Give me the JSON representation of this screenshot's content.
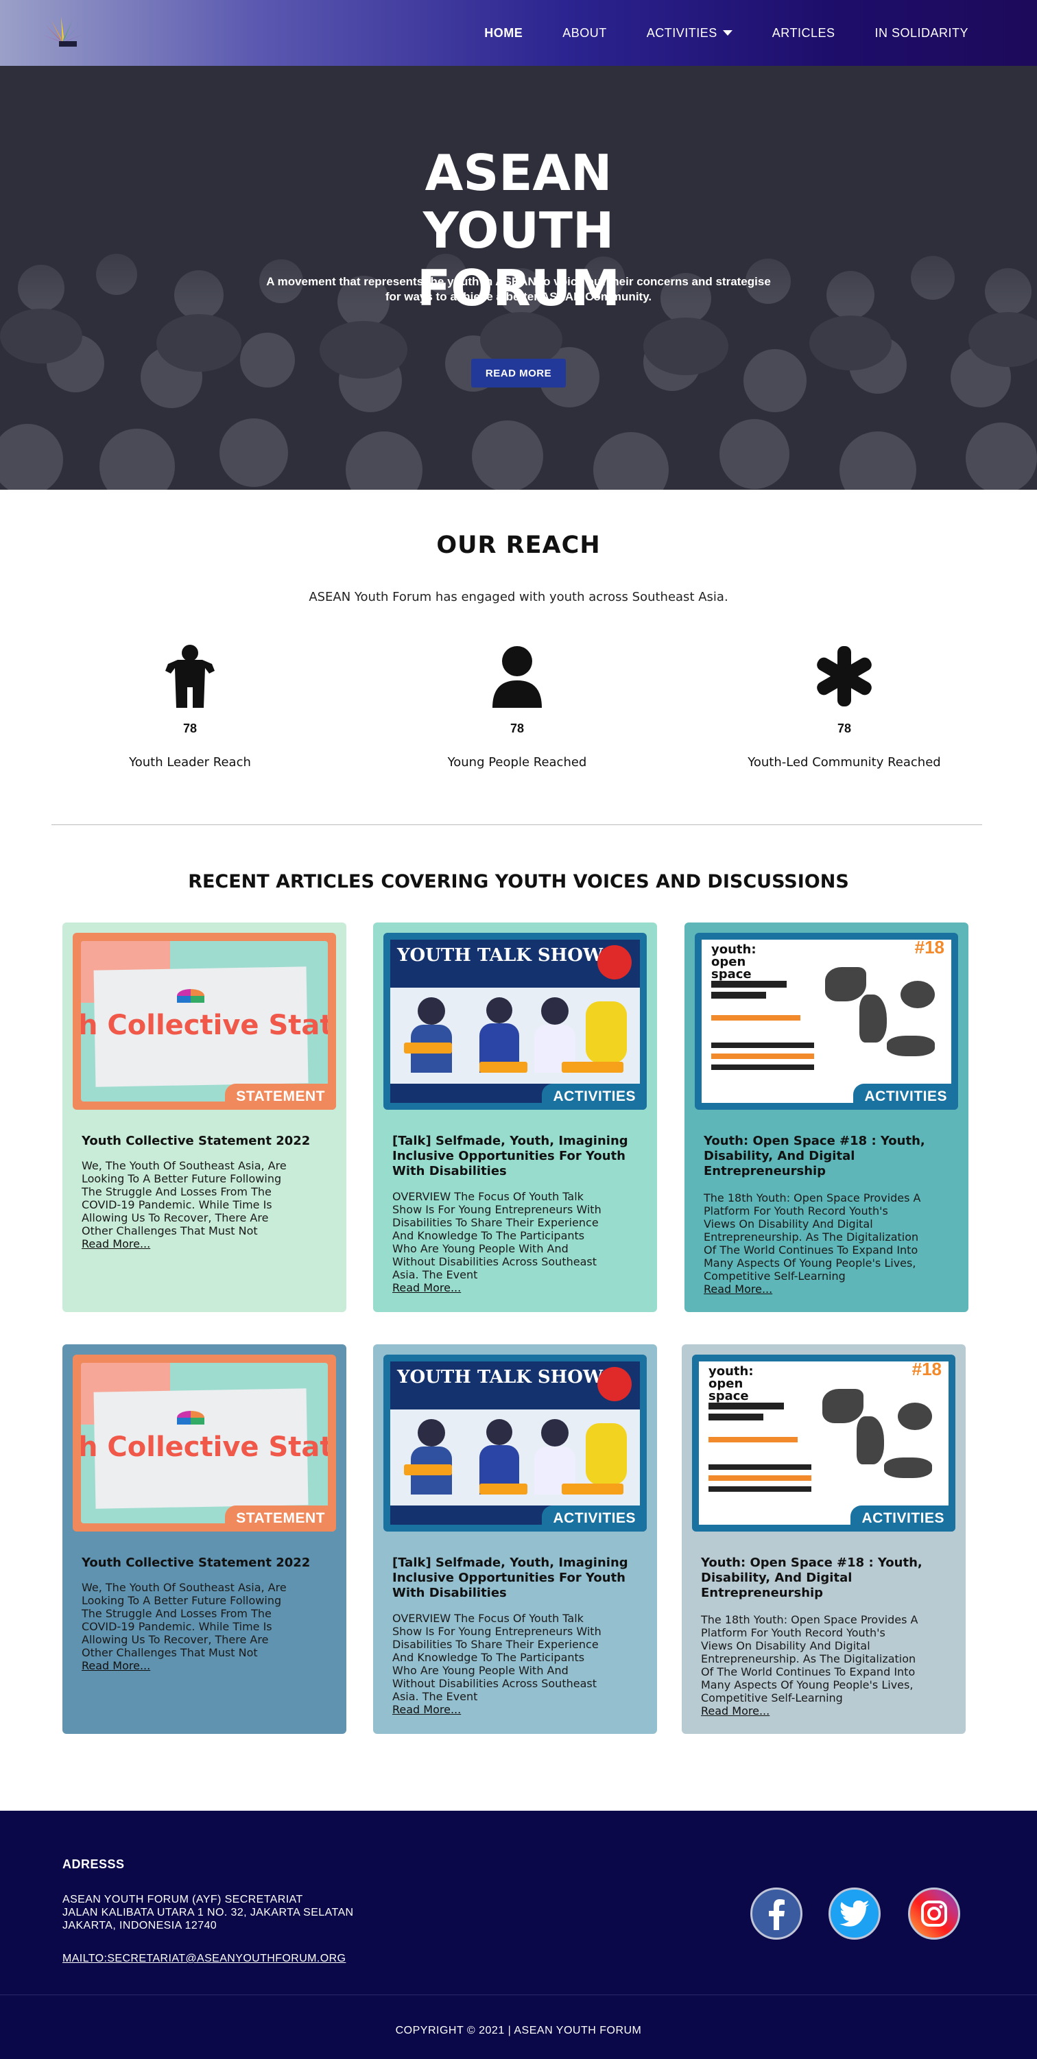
{
  "nav": {
    "items": [
      {
        "label": "HOME"
      },
      {
        "label": "ABOUT"
      },
      {
        "label": "ACTIVITIES"
      },
      {
        "label": "ARTICLES"
      },
      {
        "label": "IN SOLIDARITY"
      }
    ]
  },
  "hero": {
    "title": "ASEAN YOUTH FORUM",
    "subtitle": "A movement that represents the youth in ASEAN to voice out their concerns and strategise for ways to achieve a better ASEAN Community.",
    "button": "READ MORE"
  },
  "reach": {
    "title": "OUR REACH",
    "description": "ASEAN Youth Forum has engaged with youth across Southeast Asia.",
    "stats": [
      {
        "value": "78",
        "label": "Youth Leader Reach",
        "icon": "child-icon"
      },
      {
        "value": "78",
        "label": "Young People Reached",
        "icon": "user-icon"
      },
      {
        "value": "78",
        "label": "Youth-Led Community Reached",
        "icon": "asterisk-icon"
      }
    ]
  },
  "articles": {
    "title": "RECENT ARTICLES COVERING YOUTH VOICES AND DISCUSSIONS",
    "read_more": "Read More...",
    "cards": [
      {
        "badge": "STATEMENT",
        "title": "Youth Collective Statement 2022",
        "body": "We, The Youth Of Southeast Asia, Are Looking To A Better Future Following The Struggle And Losses From The COVID-19 Pandemic. While Time Is Allowing Us To Recover, There Are Other Challenges That Must Not",
        "image_text": "h Collective State"
      },
      {
        "badge": "ACTIVITIES",
        "title": "[Talk] Selfmade, Youth, Imagining Inclusive Opportunities For Youth With Disabilities",
        "body": "OVERVIEW The Focus Of Youth Talk Show Is For Young Entrepreneurs With Disabilities To Share Their Experience And Knowledge To The Participants Who Are Young People With And Without Disabilities Across Southeast Asia. The Event",
        "image_text": "YOUTH TALK SHOW"
      },
      {
        "badge": "ACTIVITIES",
        "title": "Youth: Open Space #18 : Youth, Disability, And Digital Entrepreneurship",
        "body": "The 18th Youth: Open Space Provides A Platform For Youth Record Youth's Views On Disability And Digital Entrepreneurship. As The Digitalization Of The World Continues To Expand Into Many Aspects Of Young People's Lives, Competitive Self-Learning",
        "image_text": "youth: open space"
      },
      {
        "badge": "STATEMENT",
        "title": "Youth Collective Statement 2022",
        "body": "We, The Youth Of Southeast Asia, Are Looking To A Better Future Following The Struggle And Losses From The COVID-19 Pandemic. While Time Is Allowing Us To Recover, There Are Other Challenges That Must Not",
        "image_text": "h Collective State"
      },
      {
        "badge": "ACTIVITIES",
        "title": "[Talk] Selfmade, Youth, Imagining Inclusive Opportunities For Youth With Disabilities",
        "body": "OVERVIEW The Focus Of Youth Talk Show Is For Young Entrepreneurs With Disabilities To Share Their Experience And Knowledge To The Participants Who Are Young People With And Without Disabilities Across Southeast Asia. The Event",
        "image_text": "YOUTH TALK SHOW"
      },
      {
        "badge": "ACTIVITIES",
        "title": "Youth: Open Space #18 : Youth, Disability, And Digital Entrepreneurship",
        "body": "The 18th Youth: Open Space Provides A Platform For Youth Record Youth's Views On Disability And Digital Entrepreneurship. As The Digitalization Of The World Continues To Expand Into Many Aspects Of Young People's Lives, Competitive Self-Learning",
        "image_text": "youth: open space"
      }
    ]
  },
  "footer": {
    "heading": "ADRESSS",
    "address_lines": [
      "ASEAN YOUTH FORUM (AYF) SECRETARIAT",
      "JALAN KALIBATA UTARA 1 NO. 32, JAKARTA SELATAN",
      "JAKARTA, INDONESIA 12740"
    ],
    "email": "MAILTO:SECRETARIAT@ASEANYOUTHFORUM.ORG",
    "copyright": "COPYRIGHT © 2021 | ASEAN YOUTH FORUM",
    "social": [
      "facebook-icon",
      "twitter-icon",
      "instagram-icon"
    ]
  }
}
